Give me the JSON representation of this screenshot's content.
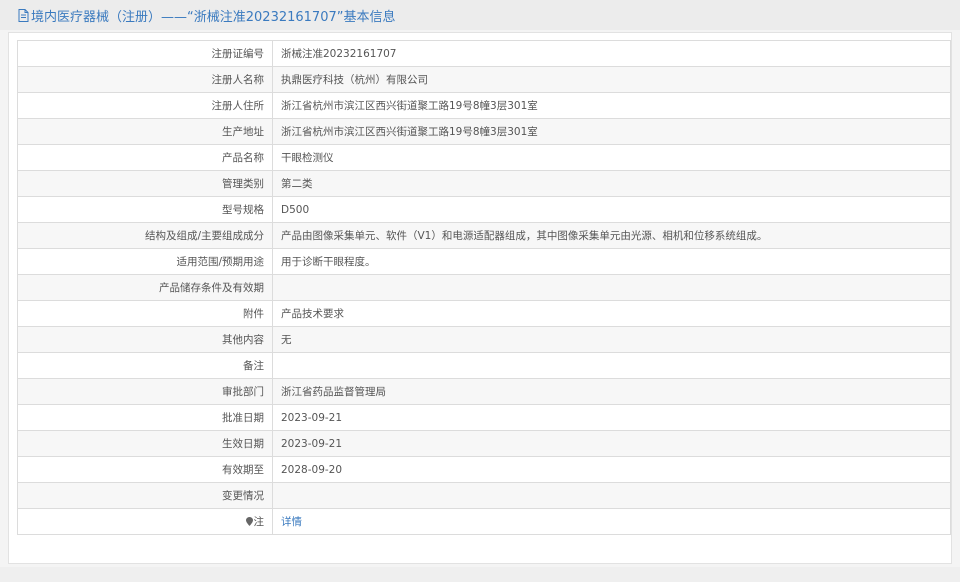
{
  "header": {
    "title_prefix": "境内医疗器械（注册）——",
    "title_quote": "“浙械注准20232161707”基本信息"
  },
  "rows": [
    {
      "label": "注册证编号",
      "value": "浙械注准20232161707"
    },
    {
      "label": "注册人名称",
      "value": "执鼎医疗科技（杭州）有限公司"
    },
    {
      "label": "注册人住所",
      "value": "浙江省杭州市滨江区西兴街道聚工路19号8幢3层301室"
    },
    {
      "label": "生产地址",
      "value": "浙江省杭州市滨江区西兴街道聚工路19号8幢3层301室"
    },
    {
      "label": "产品名称",
      "value": "干眼检测仪"
    },
    {
      "label": "管理类别",
      "value": "第二类"
    },
    {
      "label": "型号规格",
      "value": "D500"
    },
    {
      "label": "结构及组成/主要组成成分",
      "value": "产品由图像采集单元、软件（V1）和电源适配器组成，其中图像采集单元由光源、相机和位移系统组成。"
    },
    {
      "label": "适用范围/预期用途",
      "value": "用于诊断干眼程度。"
    },
    {
      "label": "产品储存条件及有效期",
      "value": ""
    },
    {
      "label": "附件",
      "value": "产品技术要求"
    },
    {
      "label": "其他内容",
      "value": "无"
    },
    {
      "label": "备注",
      "value": ""
    },
    {
      "label": "审批部门",
      "value": "浙江省药品监督管理局"
    },
    {
      "label": "批准日期",
      "value": "2023-09-21"
    },
    {
      "label": "生效日期",
      "value": "2023-09-21"
    },
    {
      "label": "有效期至",
      "value": "2028-09-20"
    },
    {
      "label": "变更情况",
      "value": ""
    }
  ],
  "note_row": {
    "label": "注",
    "link": "详情"
  },
  "colors": {
    "accent": "#3a7abf",
    "border": "#dcdcdc",
    "stripe": "#f7f7f7"
  },
  "icons": {
    "header": "document-icon",
    "note": "pin-icon"
  }
}
